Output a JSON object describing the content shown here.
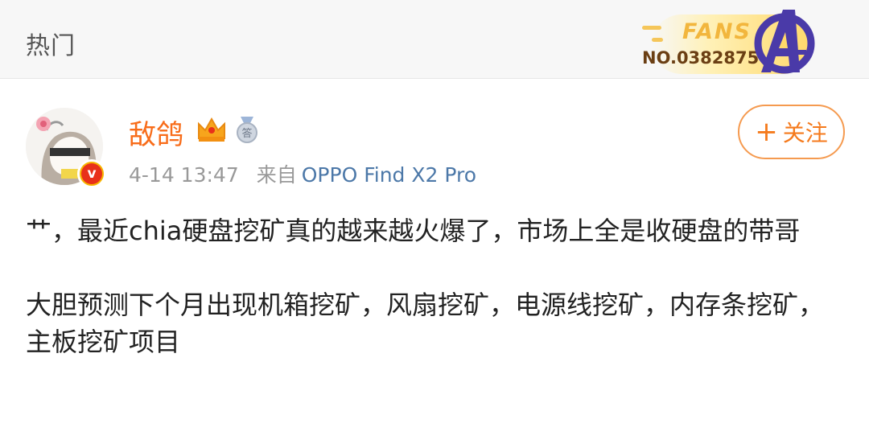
{
  "header": {
    "title": "热门",
    "fans_badge": {
      "label": "FANS",
      "number": "NO.0382875",
      "colors": {
        "gold": "#f2b63d",
        "number": "#6b3f14",
        "logo": "#4a3aa8"
      }
    }
  },
  "post": {
    "author": {
      "name": "敌鸽",
      "verified_icon": "verified-v-icon",
      "badges": [
        "crown-icon",
        "medal-icon"
      ],
      "name_color": "#f86c19"
    },
    "timestamp": "4-14 13:47",
    "source_label": "来自",
    "device": "OPPO Find X2 Pro",
    "follow_button": {
      "plus": "+",
      "label": "关注"
    },
    "paragraphs": [
      "艹，最近chia硬盘挖矿真的越来越火爆了，市场上全是收硬盘的带哥",
      "大胆预测下个月出现机箱挖矿，风扇挖矿，电源线挖矿，内存条挖矿，主板挖矿项目"
    ]
  }
}
